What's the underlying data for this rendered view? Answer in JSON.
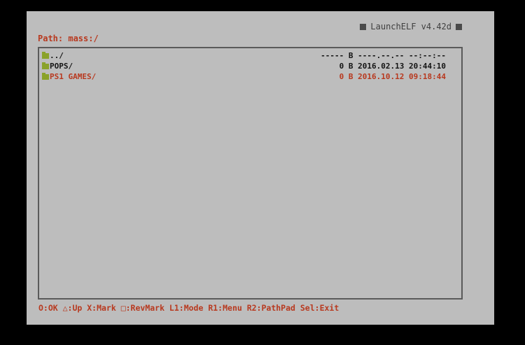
{
  "header": {
    "app_title": "LaunchELF v4.42d",
    "path": "Path: mass:/"
  },
  "files": [
    {
      "name": "../",
      "size": "----- B",
      "date": "----.--.--",
      "time": "--:--:--",
      "style": "dark"
    },
    {
      "name": "POPS/",
      "size": "0 B",
      "date": "2016.02.13",
      "time": "20:44:10",
      "style": "dark"
    },
    {
      "name": "PS1 GAMES/",
      "size": "0 B",
      "date": "2016.10.12",
      "time": "09:18:44",
      "style": "red"
    }
  ],
  "footer": {
    "controls": "O:OK △:Up X:Mark □:RevMark L1:Mode R1:Menu R2:PathPad Sel:Exit"
  },
  "icons": {
    "title_left": "square-icon",
    "title_right": "square-icon",
    "entry": "folder-icon"
  },
  "colors": {
    "screen_bg": "#bdbdbd",
    "accent_red": "#b8391f",
    "folder_green": "#8aa22a",
    "text_dark": "#141414"
  }
}
